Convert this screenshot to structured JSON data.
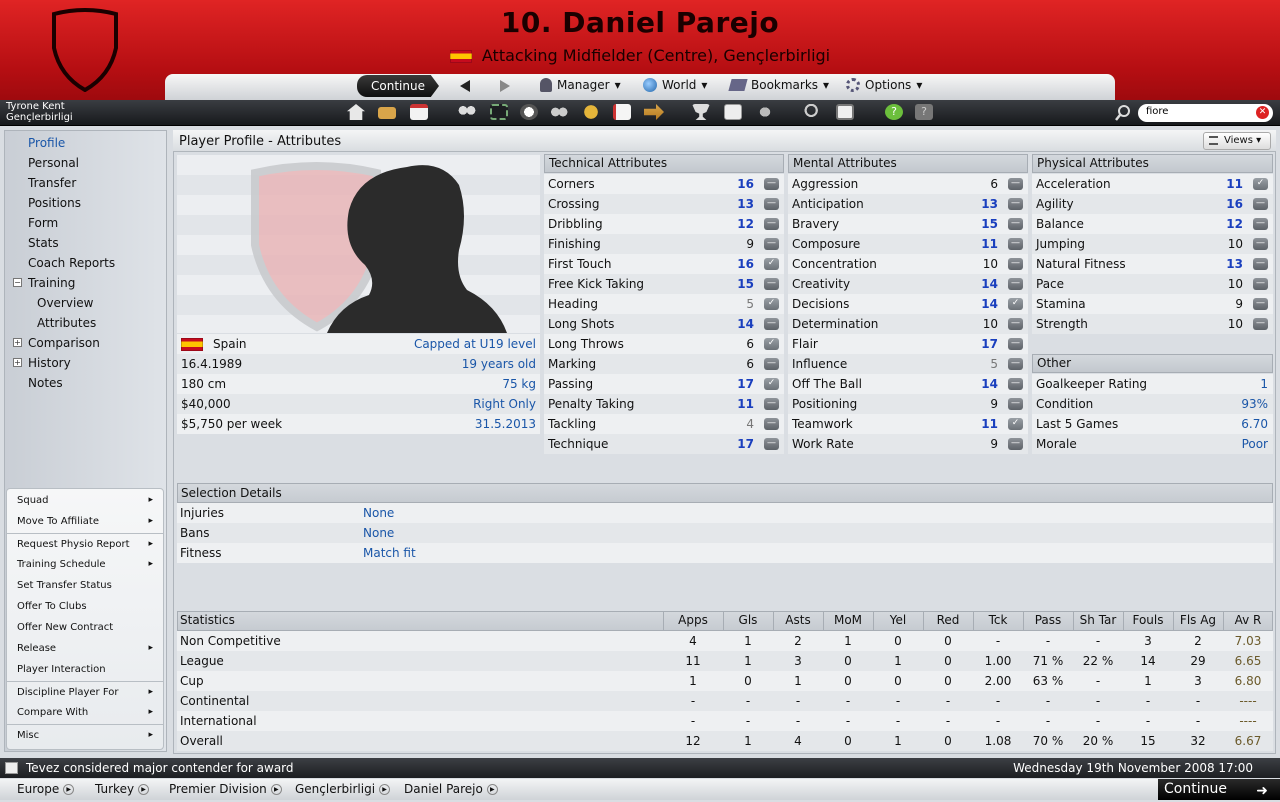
{
  "header": {
    "title": "10. Daniel Parejo",
    "subtitle": "Attacking Midfielder (Centre), Gençlerbirligi",
    "accent_color": "#c8141a"
  },
  "nav": {
    "continue_label": "Continue",
    "manager_label": "Manager",
    "world_label": "World",
    "bookmarks_label": "Bookmarks",
    "options_label": "Options"
  },
  "user": {
    "name": "Tyrone Kent",
    "club": "Gençlerbirligi"
  },
  "search": {
    "value": "fiore"
  },
  "sidebar": {
    "items": [
      {
        "label": "Profile",
        "active": true
      },
      {
        "label": "Personal"
      },
      {
        "label": "Transfer"
      },
      {
        "label": "Positions"
      },
      {
        "label": "Form"
      },
      {
        "label": "Stats"
      },
      {
        "label": "Coach Reports"
      },
      {
        "label": "Training",
        "expander": "−"
      },
      {
        "label": "Overview",
        "sub": true
      },
      {
        "label": "Attributes",
        "sub": true
      },
      {
        "label": "Comparison",
        "expander": "+"
      },
      {
        "label": "History",
        "expander": "+"
      },
      {
        "label": "Notes"
      }
    ]
  },
  "actions": [
    {
      "label": "Squad",
      "chevron": true
    },
    {
      "label": "Move To Affiliate",
      "chevron": true
    },
    {
      "label": "Request Physio Report",
      "chevron": true
    },
    {
      "label": "Training Schedule",
      "chevron": true
    },
    {
      "label": "Set Transfer Status"
    },
    {
      "label": "Offer To Clubs"
    },
    {
      "label": "Offer New Contract"
    },
    {
      "label": "Release",
      "chevron": true
    },
    {
      "label": "Player Interaction"
    },
    {
      "label": "Discipline Player For",
      "chevron": true
    },
    {
      "label": "Compare With",
      "chevron": true
    },
    {
      "label": "Misc",
      "chevron": true
    }
  ],
  "main": {
    "title": "Player Profile - Attributes",
    "views_label": "Views"
  },
  "profile": {
    "nationality": "Spain",
    "caps": "Capped at U19 level",
    "dob": "16.4.1989",
    "age": "19 years old",
    "height": "180 cm",
    "weight": "75 kg",
    "value": "$40,000",
    "foot": "Right Only",
    "wage": "$5,750 per week",
    "contract": "31.5.2013"
  },
  "technical": {
    "header": "Technical Attributes",
    "rows": [
      {
        "name": "Corners",
        "value": "16",
        "style": "hi",
        "trend": "flat"
      },
      {
        "name": "Crossing",
        "value": "13",
        "style": "hi",
        "trend": "flat"
      },
      {
        "name": "Dribbling",
        "value": "12",
        "style": "hi",
        "trend": "flat"
      },
      {
        "name": "Finishing",
        "value": "9",
        "style": "",
        "trend": "flat"
      },
      {
        "name": "First Touch",
        "value": "16",
        "style": "hi",
        "trend": "up"
      },
      {
        "name": "Free Kick Taking",
        "value": "15",
        "style": "hi",
        "trend": "flat"
      },
      {
        "name": "Heading",
        "value": "5",
        "style": "lo",
        "trend": "up"
      },
      {
        "name": "Long Shots",
        "value": "14",
        "style": "hi",
        "trend": "flat"
      },
      {
        "name": "Long Throws",
        "value": "6",
        "style": "",
        "trend": "up"
      },
      {
        "name": "Marking",
        "value": "6",
        "style": "",
        "trend": "flat"
      },
      {
        "name": "Passing",
        "value": "17",
        "style": "hi",
        "trend": "up"
      },
      {
        "name": "Penalty Taking",
        "value": "11",
        "style": "hi",
        "trend": "flat"
      },
      {
        "name": "Tackling",
        "value": "4",
        "style": "lo",
        "trend": "flat"
      },
      {
        "name": "Technique",
        "value": "17",
        "style": "hi",
        "trend": "flat"
      }
    ]
  },
  "mental": {
    "header": "Mental Attributes",
    "rows": [
      {
        "name": "Aggression",
        "value": "6",
        "style": "",
        "trend": "flat"
      },
      {
        "name": "Anticipation",
        "value": "13",
        "style": "hi",
        "trend": "flat"
      },
      {
        "name": "Bravery",
        "value": "15",
        "style": "hi",
        "trend": "flat"
      },
      {
        "name": "Composure",
        "value": "11",
        "style": "hi",
        "trend": "flat"
      },
      {
        "name": "Concentration",
        "value": "10",
        "style": "",
        "trend": "flat"
      },
      {
        "name": "Creativity",
        "value": "14",
        "style": "hi",
        "trend": "flat"
      },
      {
        "name": "Decisions",
        "value": "14",
        "style": "hi",
        "trend": "up"
      },
      {
        "name": "Determination",
        "value": "10",
        "style": "",
        "trend": "flat"
      },
      {
        "name": "Flair",
        "value": "17",
        "style": "hi",
        "trend": "flat"
      },
      {
        "name": "Influence",
        "value": "5",
        "style": "lo",
        "trend": "flat"
      },
      {
        "name": "Off The Ball",
        "value": "14",
        "style": "hi",
        "trend": "flat"
      },
      {
        "name": "Positioning",
        "value": "9",
        "style": "",
        "trend": "flat"
      },
      {
        "name": "Teamwork",
        "value": "11",
        "style": "hi",
        "trend": "up"
      },
      {
        "name": "Work Rate",
        "value": "9",
        "style": "",
        "trend": "flat"
      }
    ]
  },
  "physical": {
    "header": "Physical Attributes",
    "rows": [
      {
        "name": "Acceleration",
        "value": "11",
        "style": "hi",
        "trend": "up"
      },
      {
        "name": "Agility",
        "value": "16",
        "style": "hi",
        "trend": "flat"
      },
      {
        "name": "Balance",
        "value": "12",
        "style": "hi",
        "trend": "flat"
      },
      {
        "name": "Jumping",
        "value": "10",
        "style": "",
        "trend": "flat"
      },
      {
        "name": "Natural Fitness",
        "value": "13",
        "style": "hi",
        "trend": "flat"
      },
      {
        "name": "Pace",
        "value": "10",
        "style": "",
        "trend": "flat"
      },
      {
        "name": "Stamina",
        "value": "9",
        "style": "",
        "trend": "flat"
      },
      {
        "name": "Strength",
        "value": "10",
        "style": "",
        "trend": "flat"
      }
    ]
  },
  "other": {
    "header": "Other",
    "rows": [
      {
        "name": "Goalkeeper Rating",
        "value": "1"
      },
      {
        "name": "Condition",
        "value": "93%"
      },
      {
        "name": "Last 5 Games",
        "value": "6.70"
      },
      {
        "name": "Morale",
        "value": "Poor"
      }
    ]
  },
  "selection": {
    "header": "Selection Details",
    "rows": [
      {
        "name": "Injuries",
        "value": "None"
      },
      {
        "name": "Bans",
        "value": "None"
      },
      {
        "name": "Fitness",
        "value": "Match fit"
      }
    ]
  },
  "statistics": {
    "header": "Statistics",
    "columns": [
      "Apps",
      "Gls",
      "Asts",
      "MoM",
      "Yel",
      "Red",
      "Tck",
      "Pass",
      "Sh Tar",
      "Fouls",
      "Fls Ag",
      "Av R"
    ],
    "rows": [
      {
        "label": "Non Competitive",
        "cells": [
          "4",
          "1",
          "2",
          "1",
          "0",
          "0",
          "-",
          "-",
          "-",
          "3",
          "2",
          "7.03"
        ]
      },
      {
        "label": "League",
        "cells": [
          "11",
          "1",
          "3",
          "0",
          "1",
          "0",
          "1.00",
          "71 %",
          "22 %",
          "14",
          "29",
          "6.65"
        ]
      },
      {
        "label": "Cup",
        "cells": [
          "1",
          "0",
          "1",
          "0",
          "0",
          "0",
          "2.00",
          "63 %",
          "-",
          "1",
          "3",
          "6.80"
        ]
      },
      {
        "label": "Continental",
        "cells": [
          "-",
          "-",
          "-",
          "-",
          "-",
          "-",
          "-",
          "-",
          "-",
          "-",
          "-",
          "----"
        ]
      },
      {
        "label": "International",
        "cells": [
          "-",
          "-",
          "-",
          "-",
          "-",
          "-",
          "-",
          "-",
          "-",
          "-",
          "-",
          "----"
        ]
      },
      {
        "label": "Overall",
        "cells": [
          "12",
          "1",
          "4",
          "0",
          "1",
          "0",
          "1.08",
          "70 %",
          "20 %",
          "15",
          "32",
          "6.67"
        ]
      }
    ]
  },
  "news": {
    "headline": "Tevez considered major contender for award",
    "datetime": "Wednesday 19th November 2008 17:00"
  },
  "breadcrumbs": [
    "Europe",
    "Turkey",
    "Premier Division",
    "Gençlerbirligi",
    "Daniel Parejo"
  ],
  "bottom": {
    "continue_label": "Continue"
  }
}
